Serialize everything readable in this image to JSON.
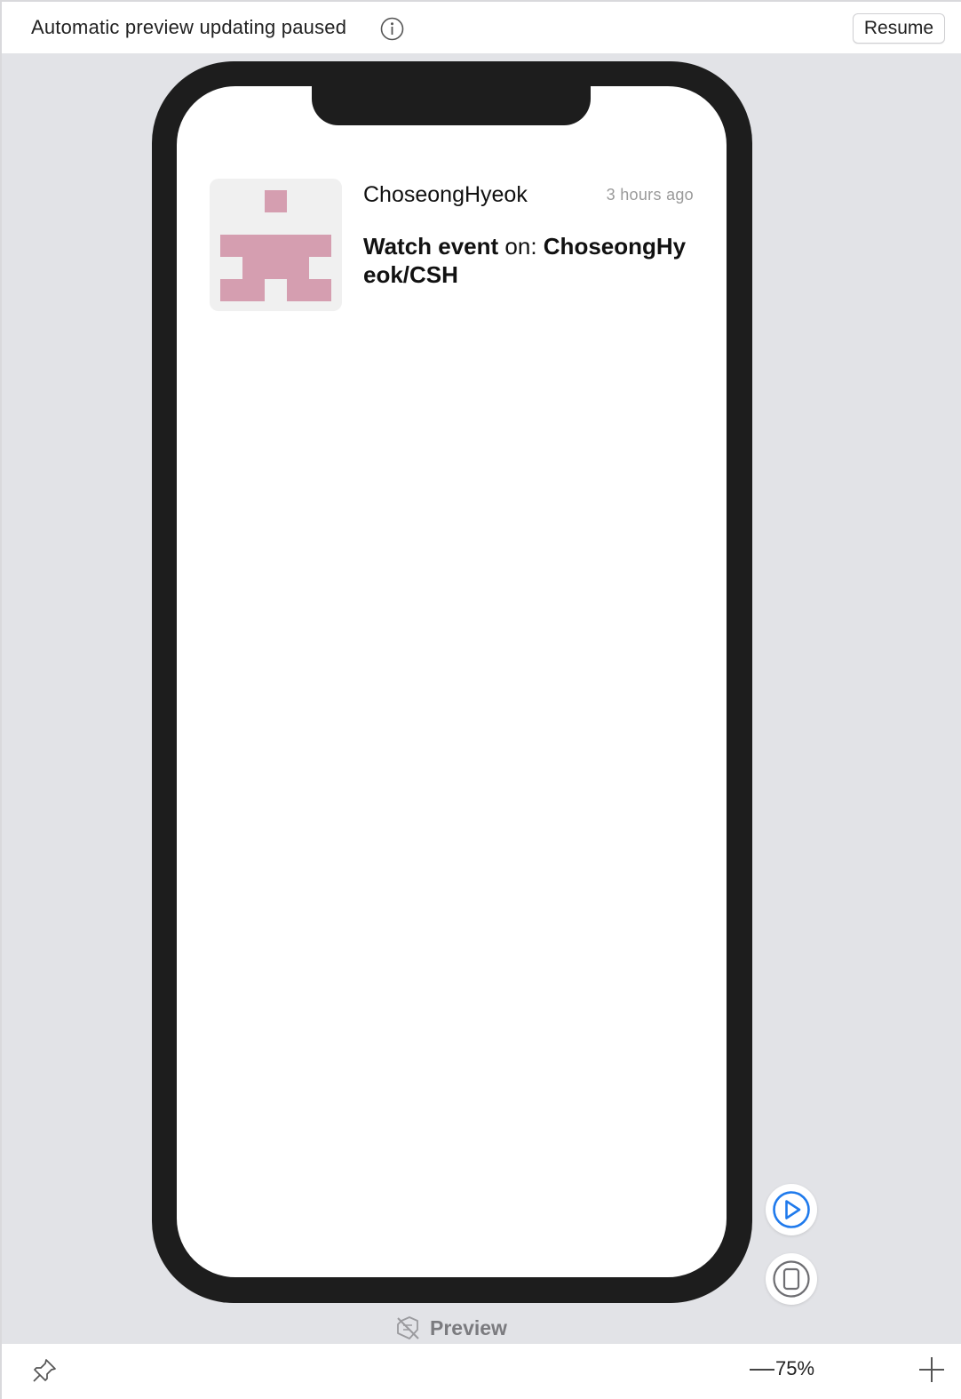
{
  "topbar": {
    "status_text": "Automatic preview updating paused",
    "info_icon": "info-circle-icon",
    "resume_label": "Resume"
  },
  "notification": {
    "avatar_icon": "identicon-avatar",
    "avatar_color": "#d59eb0",
    "username": "ChoseongHyeok",
    "timestamp": "3 hours ago",
    "event_name": "Watch event",
    "event_connector": " on: ",
    "repository": "ChoseongHyeok/CSH"
  },
  "side_controls": {
    "live_preview_icon": "play-circle-icon",
    "device_settings_icon": "device-icon",
    "accent_color": "#1f7aec"
  },
  "preview_label": {
    "icon": "preview-disabled-icon",
    "text": "Preview"
  },
  "bottombar": {
    "pin_icon": "pin-icon",
    "zoom_out_icon": "minus-icon",
    "zoom_level": "75%",
    "zoom_in_icon": "plus-icon"
  }
}
